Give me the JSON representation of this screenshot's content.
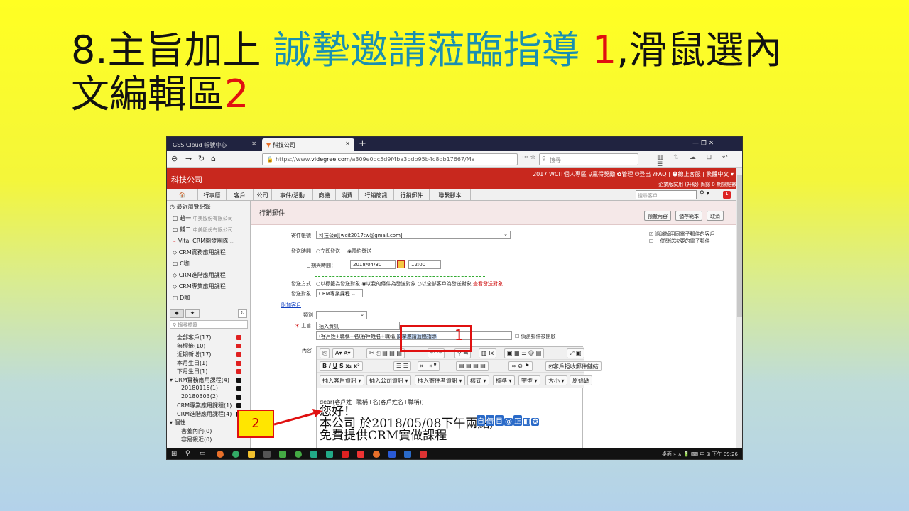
{
  "slide": {
    "title_part1": "8.主旨加上 ",
    "title_blue": "誠摯邀請蒞臨指導",
    "title_red1": " 1",
    "title_part2": ",滑鼠選內",
    "title_line2": "文編輯區",
    "title_red2": "2"
  },
  "browser": {
    "tab1": "GSS Cloud 帳號中心",
    "tab2": "科技公司",
    "tab_close": "✕",
    "new_tab": "+",
    "url_prefix": "https://www.",
    "url_domain": "videgree.com",
    "url_rest": "/a309e0dc5d9f4ba3bdb95b4c8db17667/Ma",
    "search_placeholder": "搜尋",
    "win_controls": "—   ❐   ✕"
  },
  "app": {
    "name": "科技公司",
    "top_links": "2017 WCIT個人專區   ♀贏得獎勵   ✿管理   ⏻登出   ?FAQ  |  ☻線上客服  |  繁體中文 ▾",
    "sub_line": "企業版試用 (升級) 尚餘 0 期訊點數",
    "menu": [
      "🏠",
      "行事曆",
      "客戶",
      "公司",
      "事件/活動",
      "商機",
      "消費",
      "行銷簡訊",
      "行銷郵件",
      "聯繫腳本"
    ],
    "menu_search": "搜尋客戶",
    "badge": "1"
  },
  "sidebar": {
    "recent_label": "最近瀏覽紀錄",
    "recent": [
      {
        "name": "趙一",
        "org": "中美股份有限公司"
      },
      {
        "name": "錢二",
        "org": "中美股份有限公司"
      },
      {
        "name": "Vital CRM開發團隊",
        "org": "..."
      },
      {
        "name": "CRM實務應用課程",
        "org": ""
      },
      {
        "name": "C咖",
        "org": ""
      },
      {
        "name": "CRM進階應用課程",
        "org": ""
      },
      {
        "name": "CRM專業應用課程",
        "org": ""
      },
      {
        "name": "D咖",
        "org": ""
      }
    ],
    "tag_search": "搜尋標籤...",
    "filters": [
      {
        "label": "全部客戶(17)",
        "mark": "red"
      },
      {
        "label": "無標籤(10)",
        "mark": "red"
      },
      {
        "label": "近期新增(17)",
        "mark": "red"
      },
      {
        "label": "本月生日(1)",
        "mark": "red"
      },
      {
        "label": "下月生日(1)",
        "mark": "red"
      },
      {
        "label": "▾ CRM實務應用課程(4)",
        "mark": "black"
      },
      {
        "label": "20180115(1)",
        "mark": "black"
      },
      {
        "label": "20180303(2)",
        "mark": "black"
      },
      {
        "label": "CRM專業應用課程(1)",
        "mark": "black"
      },
      {
        "label": "CRM進階應用課程(4)",
        "mark": "black"
      },
      {
        "label": "▾ 個性",
        "mark": ""
      },
      {
        "label": "害羞內向(0)",
        "mark": ""
      },
      {
        "label": "容易親近(0)",
        "mark": ""
      }
    ]
  },
  "form": {
    "page_title": "行銷郵件",
    "btn_preview": "預覽內容",
    "btn_save": "儲存範本",
    "btn_cancel": "取消",
    "sender_label": "寄件帳號",
    "sender_value": "科技公司[wcit2017tw@gmail.com]",
    "opt1": "過濾掉用同電子郵件的客戶",
    "opt2": "一併發送次要的電子郵件",
    "sendtime_label": "發送時間",
    "sendtime_now": "立即發送",
    "sendtime_sched": "預約發送",
    "date_label": "日期與時間：",
    "date_value": "2018/04/30",
    "time_value": "12:00",
    "method_label": "發送方式",
    "method_text": "以標籤為發送對象  ◉以我的條件為發送對象  ○以全部客戶為發送對象",
    "method_link": "查看發送對象",
    "target_label": "發送對象",
    "target_value": "CRM專業課程",
    "attach_link": "附加客戶",
    "category_label": "類別",
    "subject_label": "主旨",
    "subject_insert": "插入資訊",
    "subject_prefix": "(客戶姓+職稱+名(客戶姓名+職稱)",
    "subject_value": "誠摯邀請蒞臨指導",
    "track_label": "偵測郵件被開啟",
    "content_label": "內容",
    "tb_row2_custom": "客戶拒收郵件鏈結",
    "tb_row3": [
      "插入客戶資訊 ▾",
      "插入公司資訊 ▾",
      "插入寄件者資訊 ▾",
      "樣式 ▾",
      "標準 ▾",
      "字型 ▾",
      "大小 ▾",
      "原始碼"
    ],
    "line1": "dear(客戶姓+職稱+名(客戶姓名+職稱))",
    "line2": "您好！",
    "line3": "本公司 於2018/05/08下午兩點;",
    "line4": "免費提供CRM實做課程",
    "ime": [
      "自",
      "倚",
      "目",
      "@",
      "正",
      "◧",
      "✪"
    ]
  },
  "taskbar": {
    "tray": "桌面 »   ∧ 🔋 ⌨ 中 ⊞   下午 09:26"
  },
  "annotations": {
    "num1": "1",
    "num2": "2"
  }
}
